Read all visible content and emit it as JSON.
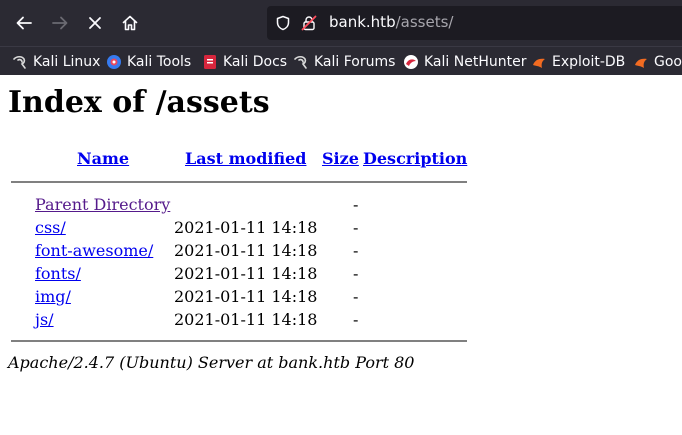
{
  "browser": {
    "url_host": "bank.htb",
    "url_path": "/assets/",
    "bookmarks": [
      {
        "label": "Kali Linux",
        "icon": "kali-dragon-icon"
      },
      {
        "label": "Kali Tools",
        "icon": "kali-tools-icon"
      },
      {
        "label": "Kali Docs",
        "icon": "kali-docs-icon"
      },
      {
        "label": "Kali Forums",
        "icon": "kali-dragon-icon"
      },
      {
        "label": "Kali NetHunter",
        "icon": "nethunter-icon"
      },
      {
        "label": "Exploit-DB",
        "icon": "exploit-db-icon"
      },
      {
        "label": "Goo",
        "icon": "exploit-db-icon"
      }
    ]
  },
  "page": {
    "title": "Index of /assets",
    "columns": {
      "name": "Name",
      "modified": "Last modified",
      "size": "Size",
      "description": "Description"
    },
    "rows": [
      {
        "name": "Parent Directory",
        "modified": "",
        "size": "-",
        "visited": true
      },
      {
        "name": "css/",
        "modified": "2021-01-11 14:18",
        "size": "-"
      },
      {
        "name": "font-awesome/",
        "modified": "2021-01-11 14:18",
        "size": "-"
      },
      {
        "name": "fonts/",
        "modified": "2021-01-11 14:18",
        "size": "-"
      },
      {
        "name": "img/",
        "modified": "2021-01-11 14:18",
        "size": "-"
      },
      {
        "name": "js/",
        "modified": "2021-01-11 14:18",
        "size": "-"
      }
    ],
    "footer": "Apache/2.4.7 (Ubuntu) Server at bank.htb Port 80"
  },
  "colors": {
    "chrome_bg": "#2b2a33",
    "urlbar_bg": "#1c1b22",
    "link": "#0000ee",
    "visited_link": "#551a8b"
  }
}
